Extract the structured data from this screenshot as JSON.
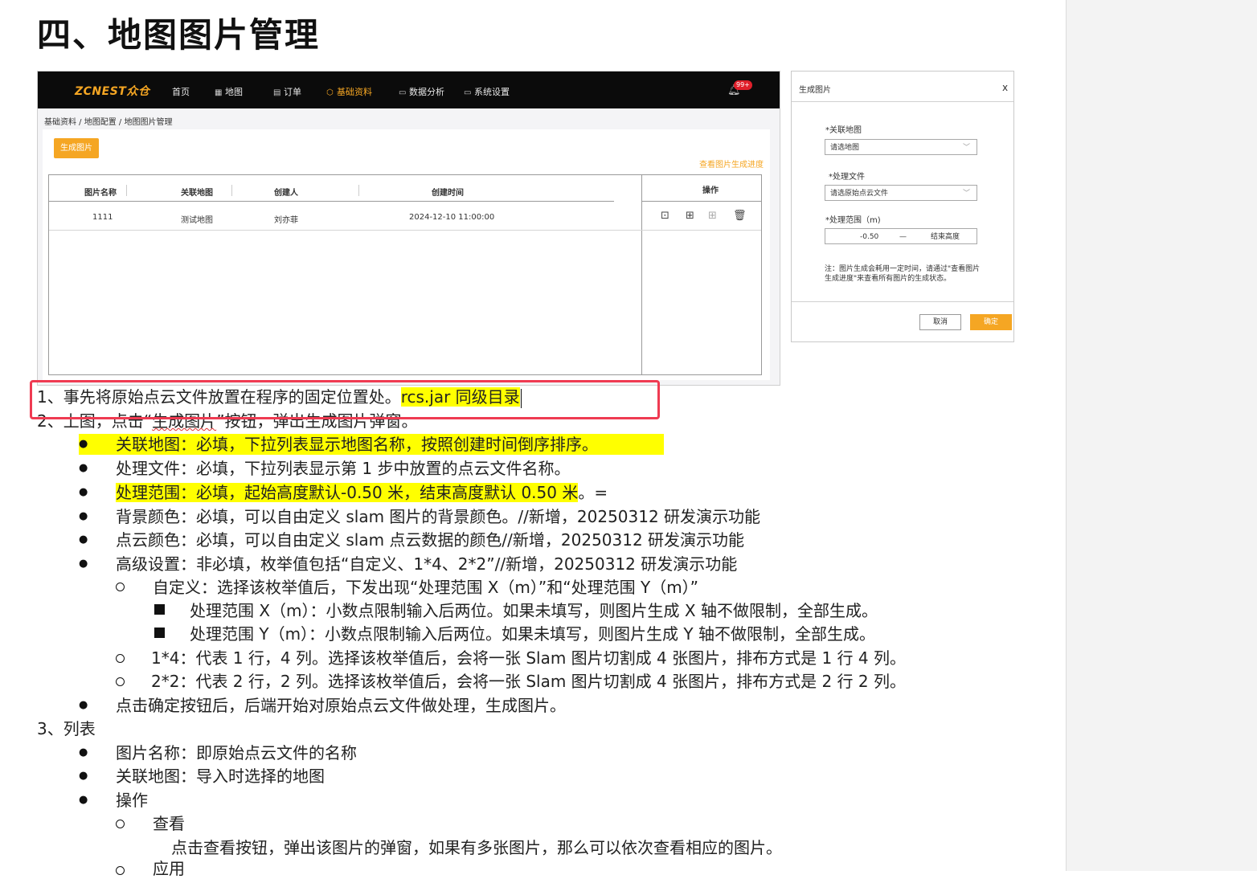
{
  "title": "四、地图图片管理",
  "app": {
    "logo": "ZCNEST众仓",
    "nav": [
      {
        "icon": "",
        "label": "首页"
      },
      {
        "icon": "▦",
        "label": "地图"
      },
      {
        "icon": "▤",
        "label": "订单"
      },
      {
        "icon": "⬡",
        "label": "基础资料"
      },
      {
        "icon": "▭",
        "label": "数据分析"
      },
      {
        "icon": "▭",
        "label": "系统设置"
      }
    ],
    "badge": "99+",
    "breadcrumb": "基础资料 / 地图配置 / 地图图片管理",
    "generate_button": "生成图片",
    "progress_link": "查看图片生成进度",
    "columns": [
      "图片名称",
      "关联地图",
      "创建人",
      "创建时间",
      "操作"
    ],
    "rows": [
      {
        "name": "1111",
        "map": "测试地图",
        "creator": "刘亦菲",
        "time": "2024-12-10 11:00:00"
      }
    ]
  },
  "dialog": {
    "title": "生成图片",
    "close": "x",
    "map_label": "*关联地图",
    "map_placeholder": "请选地图",
    "file_label": "*处理文件",
    "file_placeholder": "请选原始点云文件",
    "range_label": "*处理范围（m)",
    "range_start": "-0.50",
    "range_sep": "—",
    "range_end": "结束高度",
    "note": "注：图片生成会耗用一定时间，请通过\"查看图片生成进度\"来查看所有图片的生成状态。",
    "cancel": "取消",
    "ok": "确定"
  },
  "text": {
    "l1a": "1、事先将原始点云文件放置在程序的固定位置处。",
    "l1b": "rcs.jar 同级目录",
    "l2a": "2、上图，点击“",
    "l2b": "生成图片",
    "l2c": "”按钮，弹出生成图片弹窗。",
    "b1": "关联地图：必填，下拉列表显示地图名称，按照创建时间倒序排序。",
    "b2": "处理文件：必填，下拉列表显示第 1 步中放置的点云文件名称。",
    "b3a": "处理范围：必填，起始高度默认-0.50 米，结束高度默认 0.50 米",
    "b3b": "。=",
    "b4": "背景颜色：必填，可以自由定义 slam 图片的背景颜色。//新增，20250312 研发演示功能",
    "b5": "点云颜色：必填，可以自由定义 slam  点云数据的颜色//新增，20250312 研发演示功能",
    "b6": "高级设置：非必填，枚举值包括“自定义、1*4、2*2”//新增，20250312 研发演示功能",
    "c1": "自定义：选择该枚举值后，下发出现“处理范围 X（m）”和“处理范围 Y（m）”",
    "s1": "处理范围 X（m）：小数点限制输入后两位。如果未填写，则图片生成 X 轴不做限制，全部生成。",
    "s2": "处理范围 Y（m）：小数点限制输入后两位。如果未填写，则图片生成 Y 轴不做限制，全部生成。",
    "c2": "1*4：代表 1 行，4 列。选择该枚举值后，会将一张 Slam 图片切割成 4 张图片，排布方式是 1 行 4 列。",
    "c3": "2*2：代表 2 行，2 列。选择该枚举值后，会将一张 Slam 图片切割成 4 张图片，排布方式是 2 行 2 列。",
    "b7": "点击确定按钮后，后端开始对原始点云文件做处理，生成图片。",
    "l3": "3、列表",
    "b8": "图片名称：即原始点云文件的名称",
    "b9": "关联地图：导入时选择的地图",
    "b10": "操作",
    "c4": "查看",
    "p1": "点击查看按钮，弹出该图片的弹窗，如果有多张图片，那么可以依次查看相应的图片。",
    "c5": "应用"
  }
}
